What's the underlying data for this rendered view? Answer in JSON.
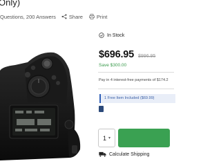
{
  "product": {
    "title_fragment": "Only)"
  },
  "meta": {
    "qa_text": "Questions, 200 Answers",
    "share_label": "Share",
    "print_label": "Print"
  },
  "purchase": {
    "stock_status": "In Stock",
    "price": "$696.95",
    "old_price": "$996.95",
    "savings": "Save $300.00",
    "installments": "Pay in 4 interest-free payments of $174.2",
    "free_item": "1 Free Item Included ($69.99)",
    "quantity": "1",
    "calculate_shipping": "Calculate Shipping"
  },
  "colors": {
    "accent_green": "#3aa152",
    "save_green": "#3a9a4c",
    "free_item_bg": "#e9eef8",
    "free_item_text": "#3a5fa6"
  },
  "icons": {
    "share": "share-icon",
    "print": "printer-icon",
    "stock": "check-circle-icon",
    "shipping": "truck-icon"
  }
}
